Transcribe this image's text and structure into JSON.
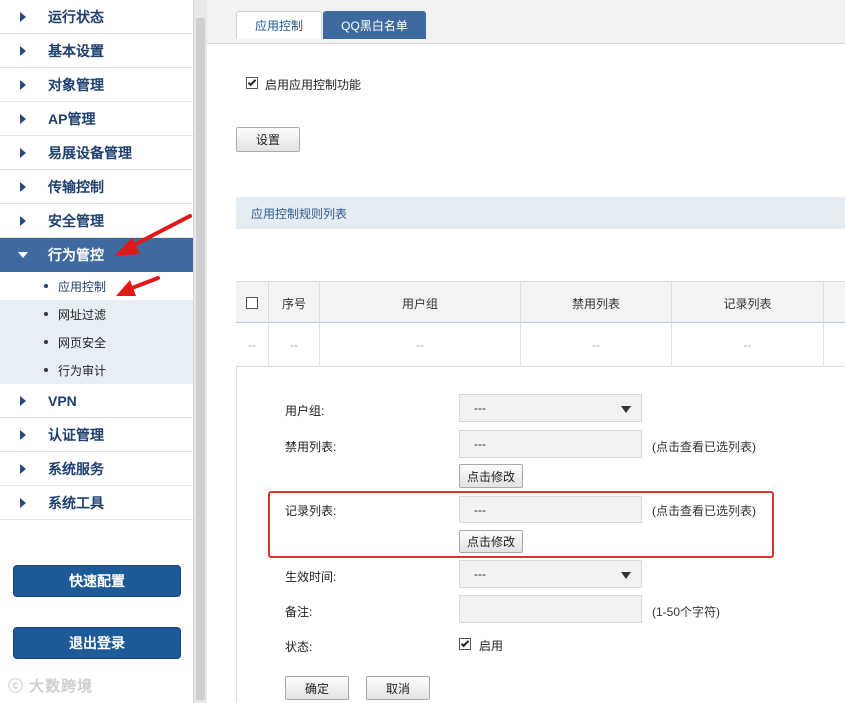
{
  "sidebar": {
    "menu": [
      {
        "label": "运行状态"
      },
      {
        "label": "基本设置"
      },
      {
        "label": "对象管理"
      },
      {
        "label": "AP管理"
      },
      {
        "label": "易展设备管理"
      },
      {
        "label": "传输控制"
      },
      {
        "label": "安全管理"
      },
      {
        "label": "行为管控",
        "active": true
      }
    ],
    "submenu": [
      {
        "label": "应用控制",
        "selected": true
      },
      {
        "label": "网址过滤"
      },
      {
        "label": "网页安全"
      },
      {
        "label": "行为审计"
      }
    ],
    "menu_after": [
      {
        "label": "VPN"
      },
      {
        "label": "认证管理"
      },
      {
        "label": "系统服务"
      },
      {
        "label": "系统工具"
      }
    ],
    "quick_config": "快速配置",
    "logout": "退出登录",
    "watermark": "大数跨境"
  },
  "tabs": [
    {
      "label": "应用控制",
      "active": true
    },
    {
      "label": "QQ黑白名单"
    }
  ],
  "enable_control": {
    "label": "启用应用控制功能",
    "checked": true
  },
  "settings_button": "设置",
  "rule_list_title": "应用控制规则列表",
  "table": {
    "headers": [
      "序号",
      "用户组",
      "禁用列表",
      "记录列表"
    ],
    "row": [
      "--",
      "--",
      "--",
      "--",
      "--"
    ]
  },
  "form": {
    "user_group": {
      "label": "用户组:",
      "value": "---"
    },
    "block_list": {
      "label": "禁用列表:",
      "value": "---",
      "hint": "(点击查看已选列表)",
      "modify": "点击修改"
    },
    "record_list": {
      "label": "记录列表:",
      "value": "---",
      "hint": "(点击查看已选列表)",
      "modify": "点击修改"
    },
    "effective_time": {
      "label": "生效时间:",
      "value": "---"
    },
    "remark": {
      "label": "备注:",
      "value": "",
      "hint": "(1-50个字符)"
    },
    "status": {
      "label": "状态:",
      "option": "启用",
      "checked": true
    },
    "confirm": "确定",
    "cancel": "取消"
  },
  "colors": {
    "accent": "#1d5a98",
    "active_menu": "#3f6aa0",
    "highlight": "#e03030"
  }
}
